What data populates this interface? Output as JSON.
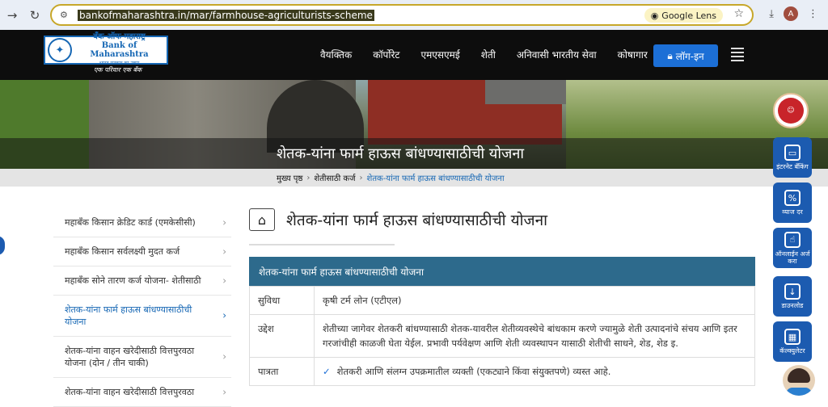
{
  "browser": {
    "url": "bankofmaharashtra.in/mar/farmhouse-agriculturists-scheme",
    "lens_label": "Google Lens",
    "avatar_letter": "A"
  },
  "logo": {
    "line1": "बँक ऑफ महाराष्ट्र",
    "line2": "Bank of Maharashtra",
    "line3": "भारत सरकार का उद्यम",
    "tagline": "एक परिवार एक बँक"
  },
  "nav": {
    "items": [
      "वैयक्तिक",
      "कॉर्पोरेट",
      "एमएसएमई",
      "शेती",
      "अनिवासी भारतीय सेवा",
      "कोषागार"
    ],
    "login_label": "लॉग-इन"
  },
  "banner": {
    "title": "शेतक-यांना फार्म हाऊस बांधण्यासाठीची योजना"
  },
  "breadcrumb": {
    "items": [
      "मुख्य पृष्ठ",
      "शेतीसाठी कर्ज",
      "शेतक-यांना फार्म हाऊस बांधण्यासाठीची योजना"
    ]
  },
  "sidebar": {
    "items": [
      {
        "label": "महाबँक किसान क्रेडिट कार्ड (एमकेसीसी)"
      },
      {
        "label": "महाबँक किसान सर्वलक्ष्यी मुदत कर्ज"
      },
      {
        "label": "महाबँक सोने तारण कर्ज योजना- शेतीसाठी"
      },
      {
        "label": "शेतक-यांना फार्म हाऊस बांधण्यासाठीची योजना"
      },
      {
        "label": "शेतक-यांना वाहन खरेदीसाठी वित्तपुरवठा योजना (दोन / तीन चाकी)"
      },
      {
        "label": "शेतक-यांना वाहन खरेदीसाठी वित्तपुरवठा"
      }
    ],
    "active_index": 3
  },
  "main": {
    "title": "शेतक-यांना फार्म हाऊस बांधण्यासाठीची योजना",
    "table_header": "शेतक-यांना फार्म हाऊस बांधण्यासाठीची योजना",
    "rows": [
      {
        "key": "सुविधा",
        "value": "कृषी टर्म लोन (एटीएल)"
      },
      {
        "key": "उद्देश",
        "value": "शेतीच्या जागेवर शेतकरी बांधण्यासाठी शेतक-यावरील शेतीव्यवस्थेचे बांधकाम करणे ज्यामुळे शेती उत्पादनांचे संचय आणि इतर गरजांचीही काळजी घेता येईल. प्रभावी पर्यवेक्षण आणि शेती व्यवस्थापन यासाठी शेतीची साधने, शेड, शेड इ."
      },
      {
        "key": "पात्रता",
        "value": "शेतकरी आणि संलग्न उपक्रमातील व्यक्ती (एकट्याने किंवा संयुक्तपणे) व्यस्त आहे."
      }
    ]
  },
  "quick_links": {
    "internet_banking": "इंटरनेट बँकिंग",
    "interest_rate": "व्याज दर",
    "online_apply": "ऑनलाईन अर्ज करा",
    "download": "डाउनलोड",
    "calculator": "कॅल्क्युलेटर"
  },
  "colors": {
    "nav_bg": "#0d0d0d",
    "accent_blue": "#1c6fd6",
    "table_header_bg": "#2d6a8c",
    "quick_btn_bg": "#1c5bb0"
  }
}
